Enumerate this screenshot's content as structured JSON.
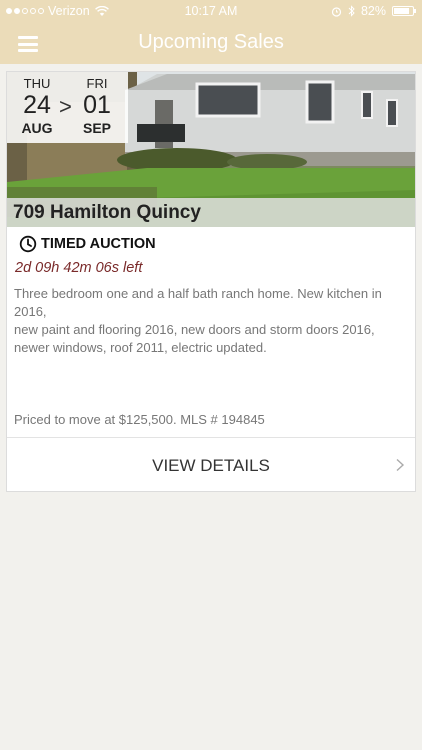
{
  "status_bar": {
    "carrier": "Verizon",
    "time": "10:17 AM",
    "battery": "82%",
    "battery_level": 0.82
  },
  "nav": {
    "title": "Upcoming Sales"
  },
  "sale": {
    "start": {
      "dow": "THU",
      "day": "24",
      "month": "AUG"
    },
    "separator": ">",
    "end": {
      "dow": "FRI",
      "day": "01",
      "month": "SEP"
    },
    "address": "709 Hamilton Quincy",
    "type": "TIMED AUCTION",
    "countdown": "2d 09h 42m 06s left",
    "description_lines": [
      "Three bedroom one and a half bath ranch home. New kitchen in 2016,",
      "new paint and flooring 2016, new doors and storm doors 2016,",
      "newer windows, roof 2011, electric updated."
    ],
    "price_text": "Priced to move at $125,500.  MLS # 194845",
    "details_label": "VIEW DETAILS"
  },
  "colors": {
    "header_bg": "#ebdcb9",
    "page_bg": "#f2f1ed",
    "countdown": "#7a2a2a"
  }
}
